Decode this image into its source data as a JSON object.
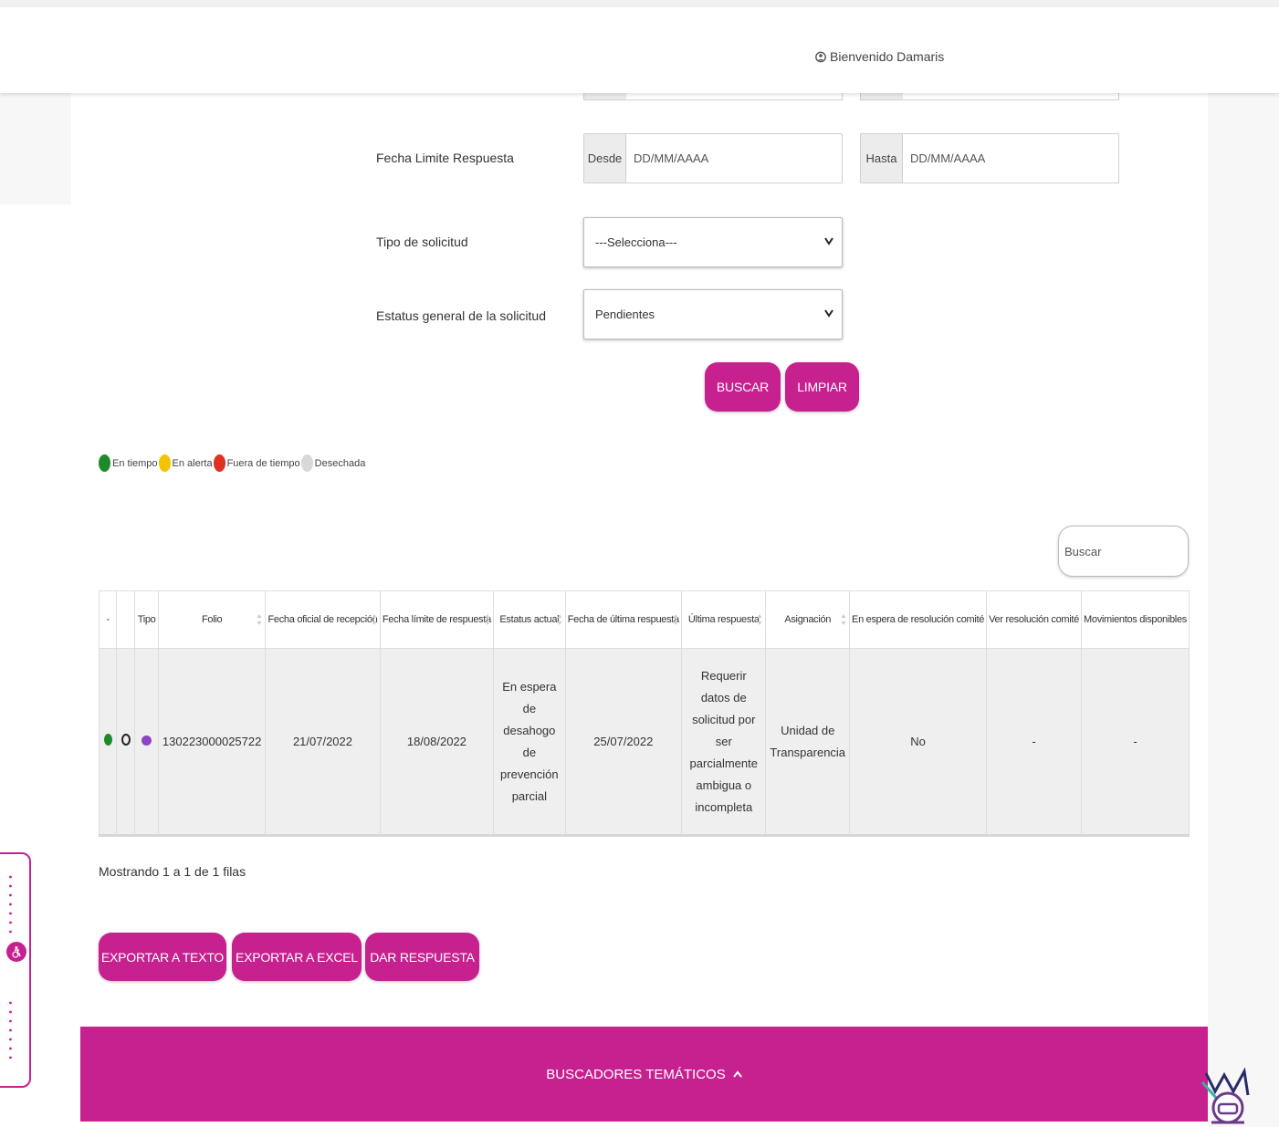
{
  "header": {
    "welcome": "Bienvenido Damaris"
  },
  "filters": {
    "fecha_limite": {
      "label": "Fecha Limite Respuesta",
      "desde_label": "Desde",
      "desde_placeholder": "DD/MM/AAAA",
      "hasta_label": "Hasta",
      "hasta_placeholder": "DD/MM/AAAA"
    },
    "tipo_solicitud": {
      "label": "Tipo de solicitud",
      "value": "---Selecciona---"
    },
    "estatus_general": {
      "label": "Estatus general de la solicitud",
      "value": "Pendientes"
    },
    "buscar_label": "BUSCAR",
    "limpiar_label": "LIMPIAR"
  },
  "legend": [
    {
      "label": "En tiempo",
      "color": "#1f8a2a"
    },
    {
      "label": "En alerta",
      "color": "#f5c300"
    },
    {
      "label": "Fuera de tiempo",
      "color": "#e03020"
    },
    {
      "label": "Desechada",
      "color": "#d8d8d8"
    }
  ],
  "table": {
    "search_placeholder": "Buscar",
    "headers": [
      "-",
      "",
      "Tipo",
      "Folio",
      "Fecha oficial de recepción",
      "Fecha límite de respuesta",
      "Estatus actual",
      "Fecha de última respuesta",
      "Última respuesta",
      "Asignación",
      "En espera de resolución comité",
      "Ver resolución comité",
      "Movimientos disponibles"
    ],
    "rows": [
      {
        "folio": "130223000025722",
        "fecha_recepcion": "21/07/2022",
        "fecha_limite": "18/08/2022",
        "estatus_actual": "En espera de desahogo de prevención parcial",
        "fecha_ultima": "25/07/2022",
        "ultima_respuesta": "Requerir datos de solicitud por ser parcialmente ambigua o incompleta",
        "asignacion": "Unidad de Transparencia",
        "espera_comite": "No",
        "ver_resolucion": "-",
        "movimientos": "-"
      }
    ],
    "rows_info": "Mostrando 1 a 1 de 1 filas"
  },
  "actions": {
    "exportar_texto": "EXPORTAR A TEXTO",
    "exportar_excel": "EXPORTAR A EXCEL",
    "dar_respuesta": "DAR RESPUESTA"
  },
  "footer": {
    "buscadores_label": "BUSCADORES TEMÁTICOS"
  },
  "colors": {
    "accent": "#c6218f"
  }
}
